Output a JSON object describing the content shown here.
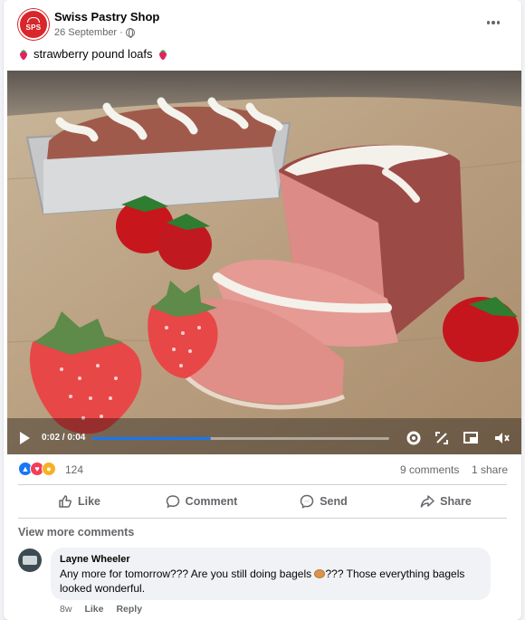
{
  "post": {
    "page_name": "Swiss Pastry Shop",
    "logo_text": "SPS",
    "date": "26 September",
    "separator": "·",
    "caption": "strawberry pound loafs"
  },
  "video": {
    "time": "0:02 / 0:04",
    "progress": 0.4
  },
  "engagement": {
    "reaction_count": "124",
    "comments": "9 comments",
    "shares": "1 share"
  },
  "actions": {
    "like": "Like",
    "comment": "Comment",
    "send": "Send",
    "share": "Share"
  },
  "comments_section": {
    "view_more": "View more comments",
    "comment": {
      "author": "Layne Wheeler",
      "text_before": "Any more for tomorrow??? Are you still doing bagels ",
      "text_after": "??? Those everything bagels looked wonderful.",
      "time": "8w",
      "like": "Like",
      "reply": "Reply"
    }
  },
  "colors": {
    "accent": "#1877f2",
    "brand_red": "#d9262b"
  }
}
